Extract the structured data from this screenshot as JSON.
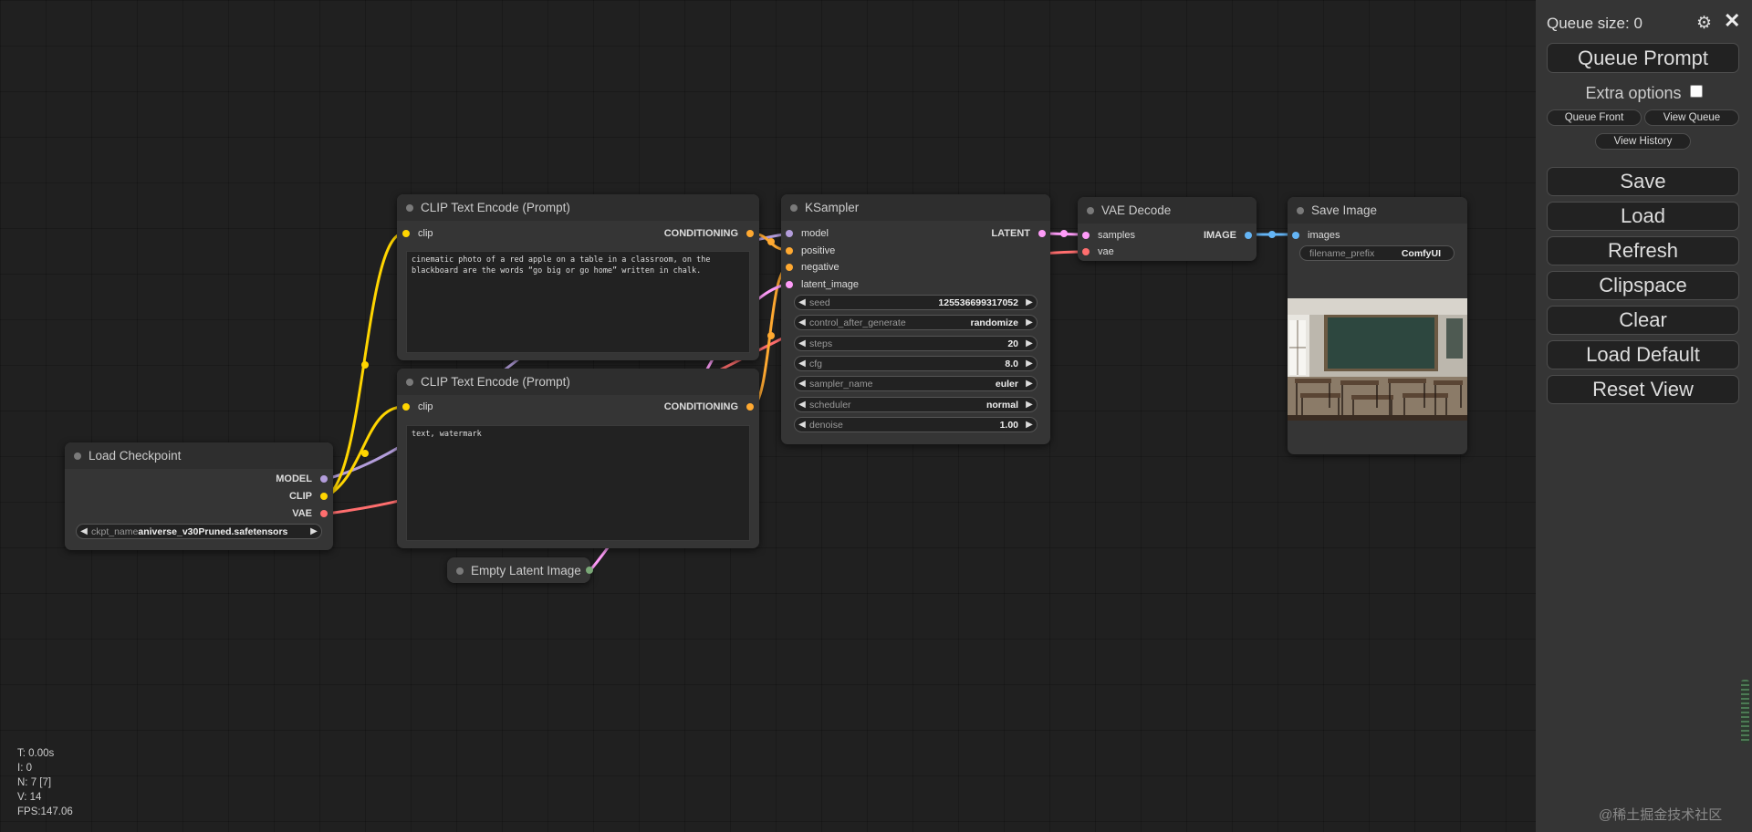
{
  "colors": {
    "model": "#b39ddb",
    "clip": "#ffd500",
    "vae": "#ff6e6e",
    "conditioning": "#ffa931",
    "latent": "#ff9cf9",
    "image": "#64b5f6",
    "background": "#202020",
    "panel": "#353535"
  },
  "nodes": {
    "clip_pos": {
      "title": "CLIP Text Encode (Prompt)",
      "input": "clip",
      "output": "CONDITIONING",
      "text": "cinematic photo of a red apple on a table in a classroom, on the blackboard are the words “go big or go home” written in chalk."
    },
    "clip_neg": {
      "title": "CLIP Text Encode (Prompt)",
      "input": "clip",
      "output": "CONDITIONING",
      "text": "text, watermark"
    },
    "load_checkpoint": {
      "title": "Load Checkpoint",
      "outputs": [
        "MODEL",
        "CLIP",
        "VAE"
      ],
      "widget_name": "ckpt_name",
      "widget_value": "aniverse_v30Pruned.safetensors"
    },
    "empty_latent": {
      "title": "Empty Latent Image"
    },
    "ksampler": {
      "title": "KSampler",
      "inputs": [
        "model",
        "positive",
        "negative",
        "latent_image"
      ],
      "output": "LATENT",
      "widgets": [
        {
          "name": "seed",
          "value": "125536699317052"
        },
        {
          "name": "control_after_generate",
          "value": "randomize"
        },
        {
          "name": "steps",
          "value": "20"
        },
        {
          "name": "cfg",
          "value": "8.0"
        },
        {
          "name": "sampler_name",
          "value": "euler"
        },
        {
          "name": "scheduler",
          "value": "normal"
        },
        {
          "name": "denoise",
          "value": "1.00"
        }
      ]
    },
    "vae_decode": {
      "title": "VAE Decode",
      "inputs": [
        "samples",
        "vae"
      ],
      "output": "IMAGE"
    },
    "save_image": {
      "title": "Save Image",
      "input": "images",
      "widget_name": "filename_prefix",
      "widget_value": "ComfyUI"
    }
  },
  "sidebar": {
    "queue_size": "Queue size: 0",
    "queue_prompt": "Queue Prompt",
    "extra_options": "Extra options",
    "extra_options_checked": false,
    "queue_front": "Queue Front",
    "view_queue": "View Queue",
    "view_history": "View History",
    "buttons": [
      "Save",
      "Load",
      "Refresh",
      "Clipspace",
      "Clear",
      "Load Default",
      "Reset View"
    ]
  },
  "stats": [
    "T: 0.00s",
    "I: 0",
    "N: 7 [7]",
    "V: 14",
    "FPS:147.06"
  ],
  "watermark": "@稀土掘金技术社区"
}
